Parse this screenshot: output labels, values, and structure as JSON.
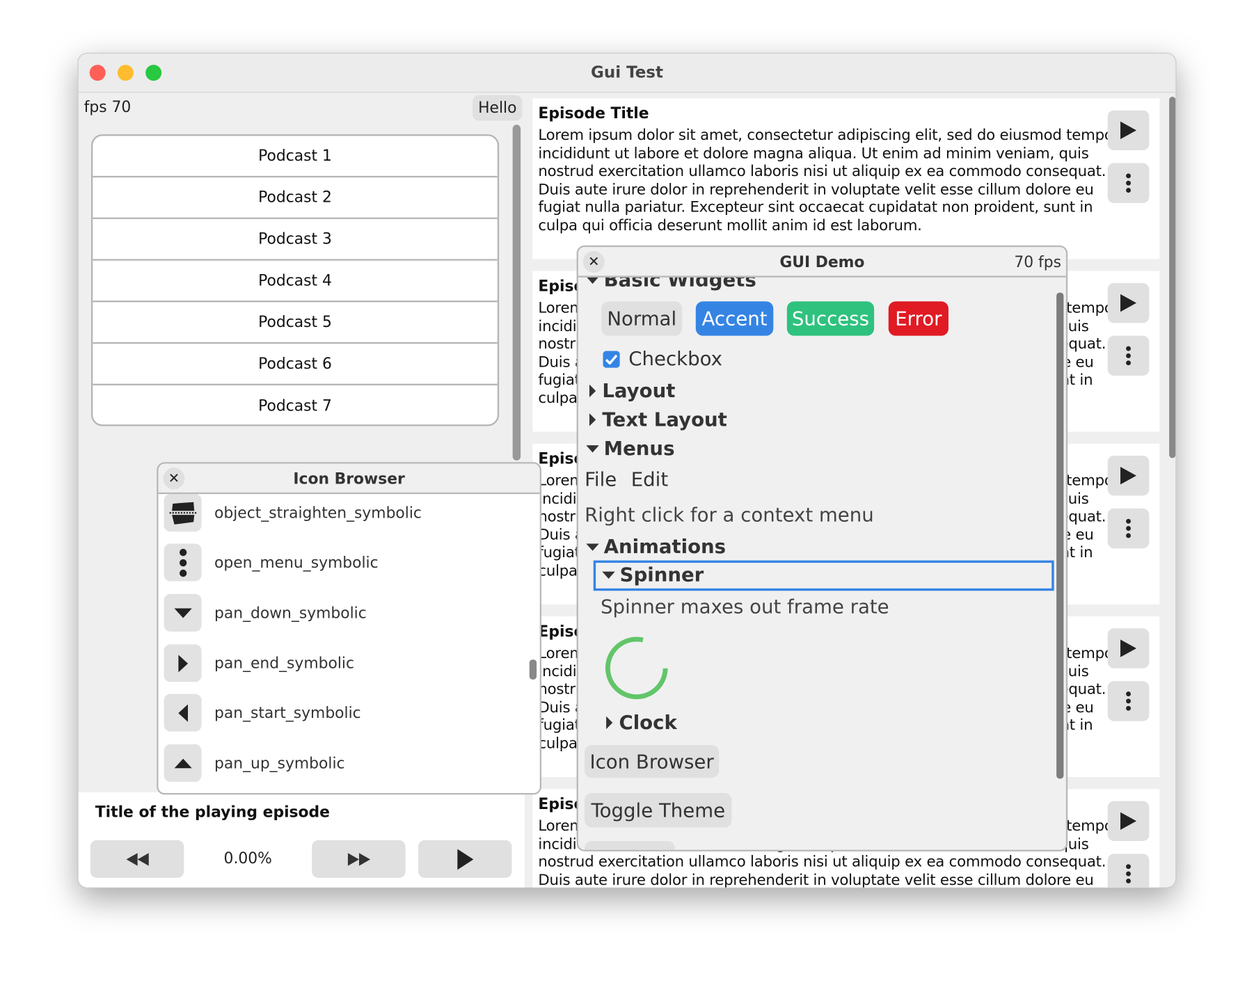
{
  "window": {
    "title": "Gui Test",
    "traffic_lights": {
      "close": "#fe5f57",
      "minimize": "#febc2e",
      "zoom": "#28c840"
    }
  },
  "left": {
    "fps_label": "fps 70",
    "hello_button": "Hello",
    "podcasts": [
      "Podcast 1",
      "Podcast 2",
      "Podcast 3",
      "Podcast 4",
      "Podcast 5",
      "Podcast 6",
      "Podcast 7"
    ],
    "player": {
      "title": "Title of the playing episode",
      "progress": "0.00%",
      "rewind_icon": "rewind-icon",
      "forward_icon": "fast-forward-icon",
      "play_icon": "play-icon"
    }
  },
  "episodes": [
    {
      "title": "Episode Title",
      "body": "Lorem ipsum dolor sit amet, consectetur adipiscing elit, sed do eiusmod tempor incididunt ut labore et dolore magna aliqua. Ut enim ad minim veniam, quis nostrud exercitation ullamco laboris nisi ut aliquip ex ea commodo consequat. Duis aute irure dolor in reprehenderit in voluptate velit esse cillum dolore eu fugiat nulla pariatur. Excepteur sint occaecat cupidatat non proident, sunt in culpa qui officia deserunt mollit anim id est laborum."
    },
    {
      "title": "Episode Title",
      "body": "Lorem ipsum dolor sit amet, consectetur adipiscing elit, sed do eiusmod tempor incididunt ut labore et dolore magna aliqua. Ut enim ad minim veniam, quis nostrud exercitation ullamco laboris nisi ut aliquip ex ea commodo consequat. Duis aute irure dolor in reprehenderit in voluptate velit esse cillum dolore eu fugiat nulla pariatur. Excepteur sint occaecat cupidatat non proident, sunt in culpa qui officia deserunt mollit anim id est laborum."
    },
    {
      "title": "Episode Title",
      "body": "Lorem ipsum dolor sit amet, consectetur adipiscing elit, sed do eiusmod tempor incididunt ut labore et dolore magna aliqua. Ut enim ad minim veniam, quis nostrud exercitation ullamco laboris nisi ut aliquip ex ea commodo consequat. Duis aute irure dolor in reprehenderit in voluptate velit esse cillum dolore eu fugiat nulla pariatur. Excepteur sint occaecat cupidatat non proident, sunt in culpa qui officia deserunt mollit anim id est laborum."
    },
    {
      "title": "Episode Title",
      "body": "Lorem ipsum dolor sit amet, consectetur adipiscing elit, sed do eiusmod tempor incididunt ut labore et dolore magna aliqua. Ut enim ad minim veniam, quis nostrud exercitation ullamco laboris nisi ut aliquip ex ea commodo consequat. Duis aute irure dolor in reprehenderit in voluptate velit esse cillum dolore eu fugiat nulla pariatur. Excepteur sint occaecat cupidatat non proident, sunt in culpa qui officia deserunt mollit anim id est laborum."
    },
    {
      "title": "Episode Title",
      "body": "Lorem ipsum dolor sit amet, consectetur adipiscing elit, sed do eiusmod tempor incididunt ut labore et dolore magna aliqua. Ut enim ad minim veniam, quis nostrud exercitation ullamco laboris nisi ut aliquip ex ea commodo consequat. Duis aute irure dolor in reprehenderit in voluptate velit esse cillum dolore eu fugiat nulla pariatur. Excepteur sint occaecat cupidatat non proident, sunt in culpa qui officia deserunt mollit anim id est laborum."
    }
  ],
  "icon_browser": {
    "title": "Icon Browser",
    "icons": [
      {
        "name": "object_straighten_symbolic",
        "icon": "object-straighten-icon"
      },
      {
        "name": "open_menu_symbolic",
        "icon": "open-menu-icon"
      },
      {
        "name": "pan_down_symbolic",
        "icon": "pan-down-icon"
      },
      {
        "name": "pan_end_symbolic",
        "icon": "pan-end-icon"
      },
      {
        "name": "pan_start_symbolic",
        "icon": "pan-start-icon"
      },
      {
        "name": "pan_up_symbolic",
        "icon": "pan-up-icon"
      }
    ]
  },
  "gui_demo": {
    "title": "GUI Demo",
    "fps": "70 fps",
    "sections": {
      "basic": "Basic Widgets",
      "layout": "Layout",
      "text_layout": "Text Layout",
      "menus": "Menus",
      "animations": "Animations",
      "spinner": "Spinner",
      "clock": "Clock"
    },
    "buttons": {
      "normal": "Normal",
      "accent": "Accent",
      "success": "Success",
      "error": "Error"
    },
    "button_colors": {
      "normal": "#e0e0e0",
      "accent": "#3584e4",
      "success": "#2ec27e",
      "error": "#e01b24"
    },
    "checkbox": {
      "label": "Checkbox",
      "checked": true
    },
    "menubar": [
      "File",
      "Edit"
    ],
    "context_hint": "Right click for a context menu",
    "spinner_note": "Spinner maxes out frame rate",
    "spinner_color": "#62c56a",
    "icon_browser_button": "Icon Browser",
    "toggle_theme_button": "Toggle Theme"
  }
}
